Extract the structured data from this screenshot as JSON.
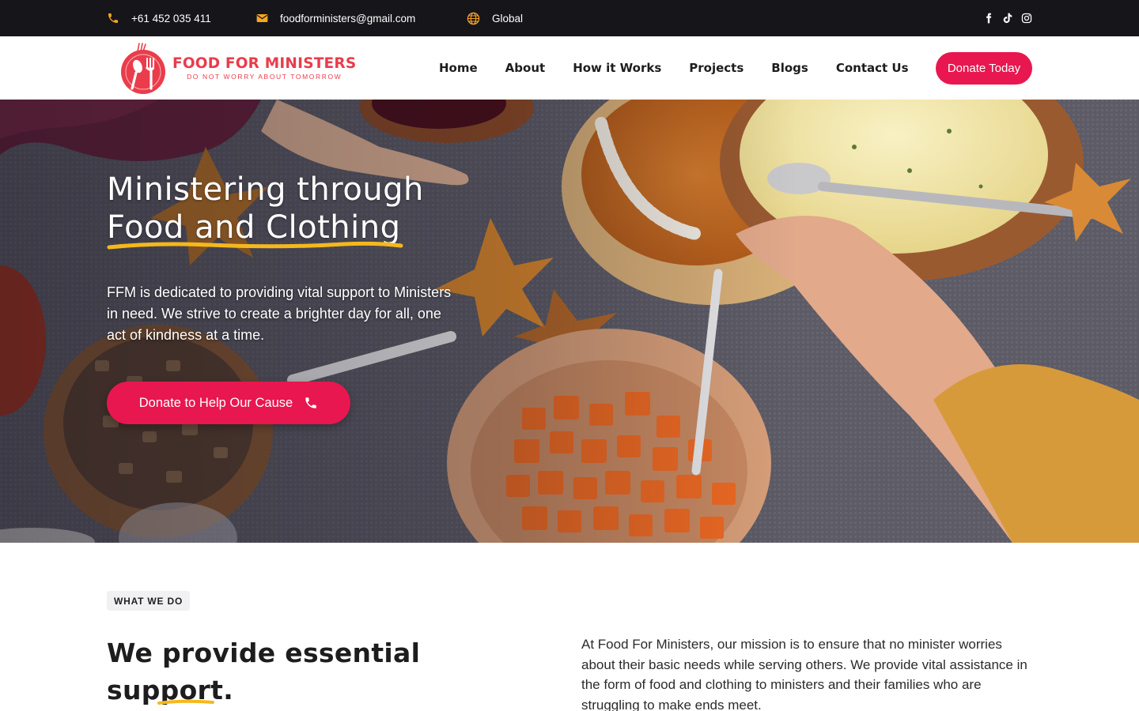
{
  "topbar": {
    "phone": "+61 452 035 411",
    "email": "foodforministers@gmail.com",
    "region": "Global",
    "socials": [
      "facebook-icon",
      "tiktok-icon",
      "instagram-icon"
    ]
  },
  "header": {
    "logo_title": "FOOD FOR MINISTERS",
    "logo_tagline": "DO NOT WORRY ABOUT TOMORROW",
    "nav": [
      "Home",
      "About",
      "How it Works",
      "Projects",
      "Blogs",
      "Contact Us"
    ],
    "donate_label": "Donate Today"
  },
  "hero": {
    "title_line1": "Ministering through",
    "title_line2": "Food and Clothing",
    "description": "FFM is dedicated to providing vital support to Ministers in need. We strive to create a brighter day for all, one act of kindness at a time.",
    "cta_label": "Donate to Help Our Cause"
  },
  "what_we_do": {
    "badge": "WHAT WE DO",
    "title_line1": "We provide essential",
    "title_line2": "support.",
    "text": "At Food For Ministers, our mission is to ensure that no minister worries about their basic needs while serving others. We provide vital assistance in the form of food and clothing to ministers and their families who are struggling to make ends meet."
  },
  "colors": {
    "accent": "#e8174f",
    "brand_red": "#ea3c4b",
    "underline_yellow": "#f5b81c",
    "topbar_bg": "#16151a",
    "icon_orange": "#f5a623"
  }
}
